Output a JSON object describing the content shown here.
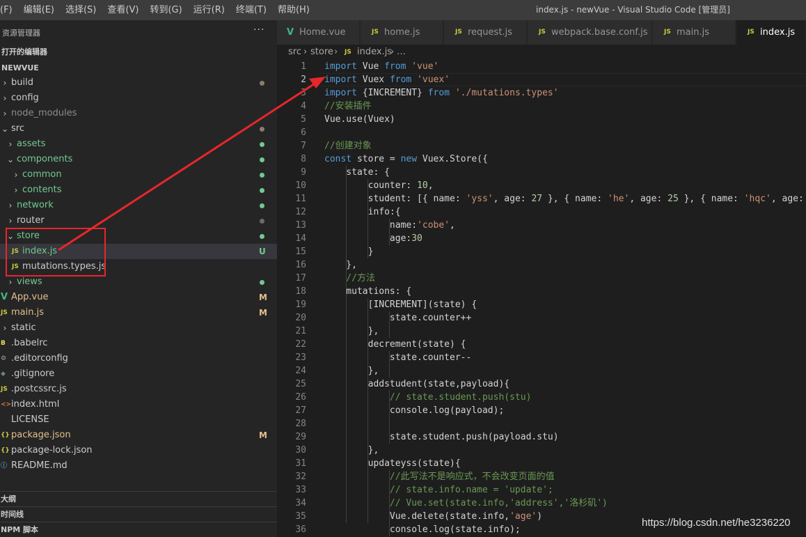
{
  "menu": [
    "(F)",
    "编辑(E)",
    "选择(S)",
    "查看(V)",
    "转到(G)",
    "运行(R)",
    "终端(T)",
    "帮助(H)"
  ],
  "window_title": "index.js - newVue - Visual Studio Code [管理员]",
  "sidebar": {
    "title": "资源管理器",
    "more": "···",
    "open_editors": "打开的编辑器",
    "project": "NEWVUE",
    "outline": "大纲",
    "timeline": "时间线",
    "npm": "NPM 脚本"
  },
  "tree": [
    {
      "label": "build",
      "chev": "›",
      "status": "dot",
      "color": "#cccccc"
    },
    {
      "label": "config",
      "chev": "›",
      "color": "#cccccc"
    },
    {
      "label": "node_modules",
      "chev": "›",
      "color": "#8c8c8c"
    },
    {
      "label": "src",
      "chev": "⌄",
      "status": "dot",
      "color": "#cccccc"
    },
    {
      "label": "assets",
      "chev": "›",
      "status": "dot-green",
      "color": "#73c991"
    },
    {
      "label": "components",
      "chev": "⌄",
      "status": "dot-green",
      "color": "#73c991"
    },
    {
      "label": "common",
      "chev": "›",
      "status": "dot-green",
      "color": "#73c991"
    },
    {
      "label": "contents",
      "chev": "›",
      "status": "dot-green",
      "color": "#73c991"
    },
    {
      "label": "network",
      "chev": "›",
      "status": "dot-green",
      "color": "#73c991"
    },
    {
      "label": "router",
      "chev": "›",
      "status": "dot-gray",
      "color": "#cccccc"
    },
    {
      "label": "store",
      "chev": "⌄",
      "status": "dot-green",
      "color": "#73c991"
    },
    {
      "label": "index.js",
      "icon": "JS",
      "badge": "U",
      "color": "#73c991"
    },
    {
      "label": "mutations.types.js",
      "icon": "JS",
      "color": "#cccccc"
    },
    {
      "label": "views",
      "chev": "›",
      "status": "dot-green",
      "color": "#73c991"
    },
    {
      "label": "App.vue",
      "icon": "V",
      "badge": "M",
      "color": "#e2c08d"
    },
    {
      "label": "main.js",
      "icon": "JS",
      "badge": "M",
      "color": "#e2c08d"
    },
    {
      "label": "static",
      "chev": "›",
      "color": "#cccccc"
    },
    {
      "label": ".babelrc",
      "icon": "B",
      "color": "#cccccc"
    },
    {
      "label": ".editorconfig",
      "icon": "⚙",
      "color": "#cccccc"
    },
    {
      "label": ".gitignore",
      "icon": "◆",
      "color": "#cccccc"
    },
    {
      "label": ".postcssrc.js",
      "icon": "JS",
      "color": "#cccccc"
    },
    {
      "label": "index.html",
      "icon": "<>",
      "color": "#cccccc"
    },
    {
      "label": "LICENSE",
      "icon": "",
      "color": "#cccccc"
    },
    {
      "label": "package.json",
      "icon": "{}",
      "badge": "M",
      "color": "#e2c08d"
    },
    {
      "label": "package-lock.json",
      "icon": "{}",
      "color": "#cccccc"
    },
    {
      "label": "README.md",
      "icon": "ⓘ",
      "color": "#cccccc"
    }
  ],
  "tabs": [
    {
      "label": "Home.vue",
      "icon": "V"
    },
    {
      "label": "home.js",
      "icon": "JS"
    },
    {
      "label": "request.js",
      "icon": "JS"
    },
    {
      "label": "webpack.base.conf.js",
      "icon": "JS"
    },
    {
      "label": "main.js",
      "icon": "JS"
    },
    {
      "label": "index.js",
      "icon": "JS",
      "active": true
    }
  ],
  "breadcrumbs": {
    "a": "src",
    "b": "store",
    "file_icon": "JS",
    "c": "index.js",
    "d": "…"
  },
  "code": [
    [
      [
        "kw",
        "import"
      ],
      [
        "p",
        " Vue "
      ],
      [
        "kw",
        "from"
      ],
      [
        "p",
        " "
      ],
      [
        "str",
        "'vue'"
      ]
    ],
    [
      [
        "kw",
        "import"
      ],
      [
        "p",
        " Vuex "
      ],
      [
        "kw",
        "from"
      ],
      [
        "p",
        " "
      ],
      [
        "str",
        "'vuex'"
      ]
    ],
    [
      [
        "kw",
        "import"
      ],
      [
        "p",
        " {INCREMENT} "
      ],
      [
        "kw",
        "from"
      ],
      [
        "p",
        " "
      ],
      [
        "str",
        "'./mutations.types'"
      ]
    ],
    [
      [
        "cmt",
        "//安装插件"
      ]
    ],
    [
      [
        "p",
        "Vue.use(Vuex)"
      ]
    ],
    [],
    [
      [
        "cmt",
        "//创建对象"
      ]
    ],
    [
      [
        "kw",
        "const"
      ],
      [
        "p",
        " store = "
      ],
      [
        "kw",
        "new"
      ],
      [
        "p",
        " Vuex.Store({"
      ]
    ],
    [
      [
        "p",
        "    state: {"
      ]
    ],
    [
      [
        "p",
        "        counter: "
      ],
      [
        "num",
        "10"
      ],
      [
        "p",
        ","
      ]
    ],
    [
      [
        "p",
        "        student: [{ name: "
      ],
      [
        "str",
        "'yss'"
      ],
      [
        "p",
        ", age: "
      ],
      [
        "num",
        "27"
      ],
      [
        "p",
        " }, { name: "
      ],
      [
        "str",
        "'he'"
      ],
      [
        "p",
        ", age: "
      ],
      [
        "num",
        "25"
      ],
      [
        "p",
        " }, { name: "
      ],
      [
        "str",
        "'hqc'"
      ],
      [
        "p",
        ", age: 2"
      ]
    ],
    [
      [
        "p",
        "        info:{"
      ]
    ],
    [
      [
        "p",
        "            name:"
      ],
      [
        "str",
        "'cobe'"
      ],
      [
        "p",
        ","
      ]
    ],
    [
      [
        "p",
        "            age:"
      ],
      [
        "num",
        "30"
      ]
    ],
    [
      [
        "p",
        "        }"
      ]
    ],
    [
      [
        "p",
        "    },"
      ]
    ],
    [
      [
        "cmt",
        "    //方法"
      ]
    ],
    [
      [
        "p",
        "    mutations: {"
      ]
    ],
    [
      [
        "p",
        "        [INCREMENT](state) {"
      ]
    ],
    [
      [
        "p",
        "            state.counter++"
      ]
    ],
    [
      [
        "p",
        "        },"
      ]
    ],
    [
      [
        "p",
        "        decrement(state) {"
      ]
    ],
    [
      [
        "p",
        "            state.counter--"
      ]
    ],
    [
      [
        "p",
        "        },"
      ]
    ],
    [
      [
        "p",
        "        addstudent(state,payload){"
      ]
    ],
    [
      [
        "cmt",
        "            // state.student.push(stu)"
      ]
    ],
    [
      [
        "p",
        "            console.log(payload);"
      ]
    ],
    [],
    [
      [
        "p",
        "            state.student.push(payload.stu)"
      ]
    ],
    [
      [
        "p",
        "        },"
      ]
    ],
    [
      [
        "p",
        "        updateyss(state){"
      ]
    ],
    [
      [
        "cmt",
        "            //此写法不是响应式，不会改变页面的值"
      ]
    ],
    [
      [
        "cmt",
        "            // state.info.name = 'update';"
      ]
    ],
    [
      [
        "cmt",
        "            // Vue.set(state.info,'address','洛杉矶')"
      ]
    ],
    [
      [
        "p",
        "            Vue.delete(state.info,"
      ],
      [
        "str",
        "'age'"
      ],
      [
        "p",
        ")"
      ]
    ],
    [
      [
        "p",
        "            console.log(state.info);"
      ]
    ]
  ],
  "current_line": 2,
  "watermark": "https://blog.csdn.net/he3236220",
  "colors": {
    "accent_red": "#e8262a",
    "js_icon": "#cbcb41",
    "vue_icon": "#41b883",
    "modified": "#e2c08d",
    "untracked": "#73c991"
  }
}
